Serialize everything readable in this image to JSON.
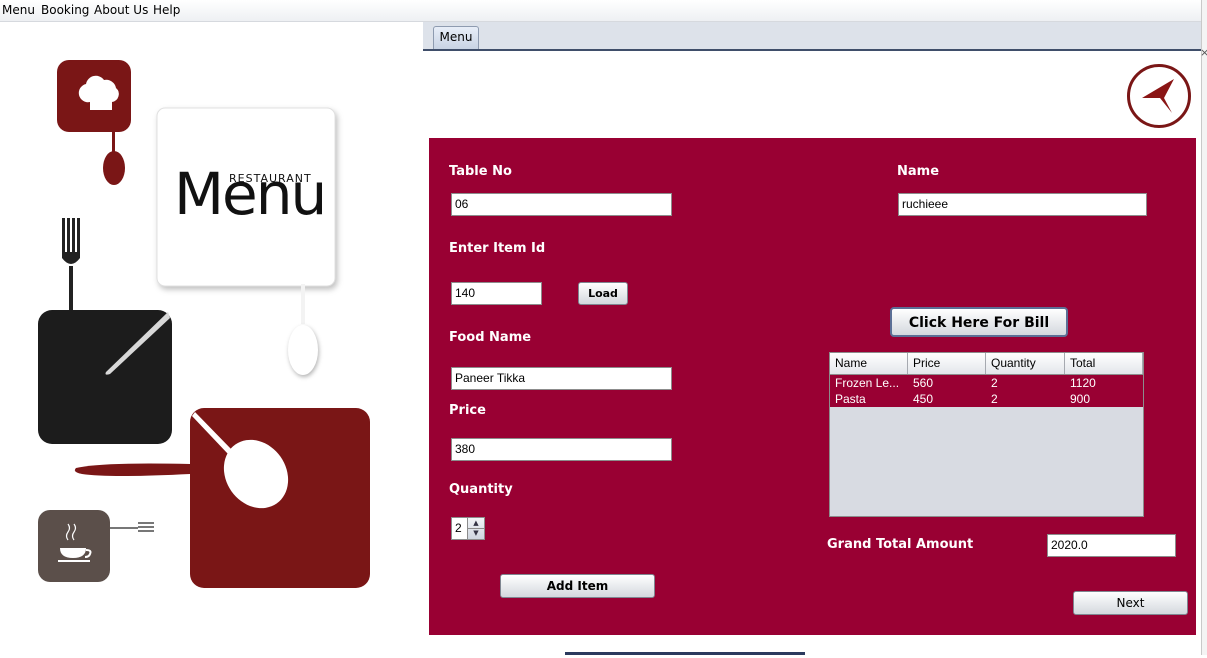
{
  "menubar": {
    "items": [
      "Menu",
      "Booking",
      "About Us",
      "Help"
    ]
  },
  "tabs": [
    {
      "label": "Menu"
    }
  ],
  "logo": {
    "small_text": "RESTAURANT",
    "big_text": "Menu"
  },
  "form": {
    "table_no": {
      "label": "Table No",
      "value": "06"
    },
    "name": {
      "label": "Name",
      "value": "ruchieee"
    },
    "item_id": {
      "label": "Enter Item Id",
      "value": "140"
    },
    "load_label": "Load",
    "food_name": {
      "label": "Food Name",
      "value": "Paneer Tikka"
    },
    "price": {
      "label": "Price",
      "value": "380"
    },
    "quantity": {
      "label": "Quantity",
      "value": "2"
    },
    "add_item_label": "Add Item",
    "bill_button_label": "Click Here For Bill",
    "grand_total": {
      "label": "Grand Total Amount",
      "value": "2020.0"
    },
    "next_label": "Next"
  },
  "bill_table": {
    "columns": [
      "Name",
      "Price",
      "Quantity",
      "Total"
    ],
    "rows": [
      {
        "name": "Frozen Le...",
        "price": "560",
        "quantity": "2",
        "total": "1120"
      },
      {
        "name": "Pasta",
        "price": "450",
        "quantity": "2",
        "total": "900"
      }
    ]
  },
  "icons": {
    "back": "back-arrow-icon"
  },
  "colors": {
    "panel": "#990033",
    "logo_red": "#7a1616"
  }
}
